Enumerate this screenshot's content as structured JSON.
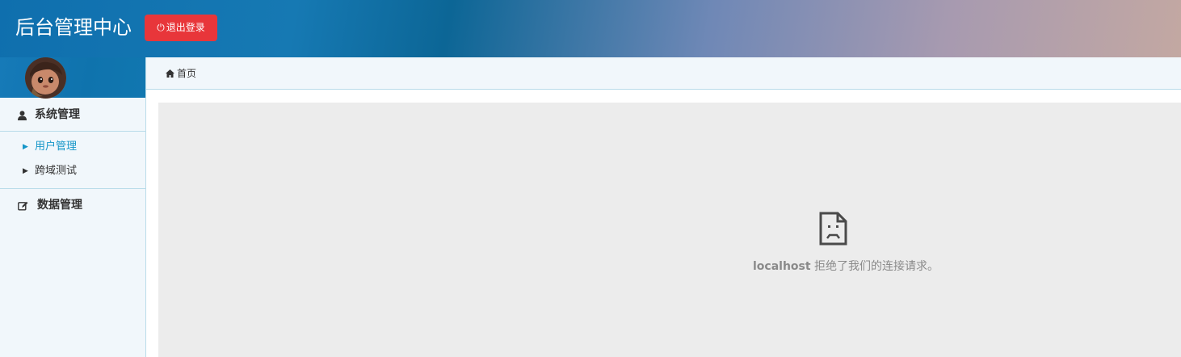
{
  "header": {
    "title": "后台管理中心",
    "logout_label": "退出登录",
    "logout_icon": "power-icon"
  },
  "sidebar": {
    "avatar": "avatar-cartoon-girl",
    "groups": [
      {
        "label": "系统管理",
        "icon": "user-icon"
      },
      {
        "label": "数据管理",
        "icon": "edit-icon"
      }
    ],
    "items": [
      {
        "label": "用户管理",
        "active": true
      },
      {
        "label": "跨域测试",
        "active": false
      }
    ]
  },
  "breadcrumb": {
    "icon": "home-icon",
    "label": "首页"
  },
  "frame": {
    "error_icon": "sad-document-icon",
    "host": "localhost",
    "message": "拒绝了我们的连接请求。"
  },
  "colors": {
    "logout_button": "#e8363a",
    "active_item": "#1596c8",
    "frame_bg": "#ececec",
    "sidebar_bg": "#f1f7fb"
  }
}
